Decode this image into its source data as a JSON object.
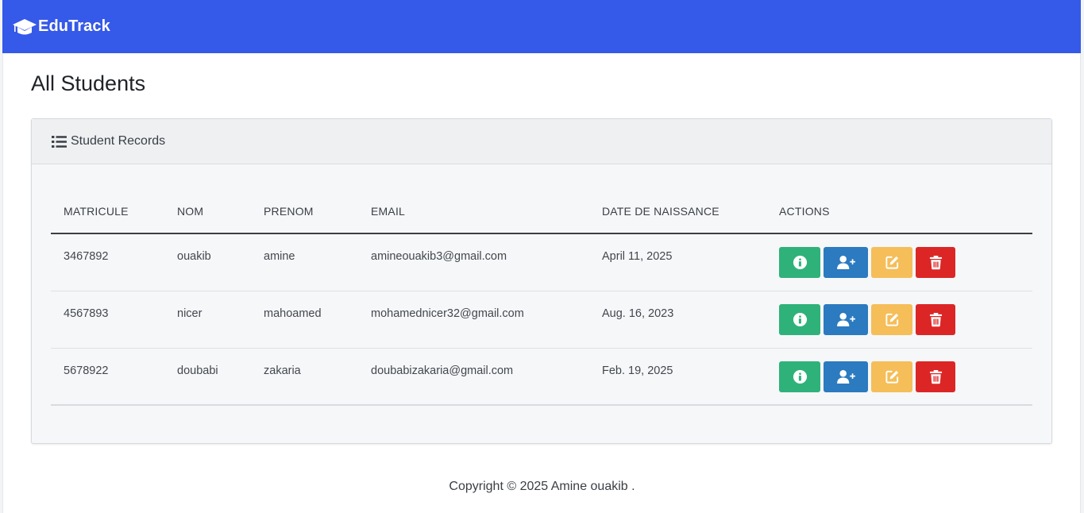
{
  "brand": {
    "name": "EduTrack",
    "icon": "graduation-cap-icon"
  },
  "page": {
    "title": "All Students"
  },
  "card": {
    "title": "Student Records",
    "icon": "list-icon"
  },
  "table": {
    "headers": [
      "MATRICULE",
      "NOM",
      "PRENOM",
      "EMAIL",
      "DATE DE NAISSANCE",
      "ACTIONS"
    ],
    "rows": [
      {
        "matricule": "3467892",
        "nom": "ouakib",
        "prenom": "amine",
        "email": "amineouakib3@gmail.com",
        "date": "April 11, 2025"
      },
      {
        "matricule": "4567893",
        "nom": "nicer",
        "prenom": "mahoamed",
        "email": "mohamednicer32@gmail.com",
        "date": "Aug. 16, 2023"
      },
      {
        "matricule": "5678922",
        "nom": "doubabi",
        "prenom": "zakaria",
        "email": "doubabizakaria@gmail.com",
        "date": "Feb. 19, 2025"
      }
    ],
    "actions": [
      {
        "name": "info",
        "icon": "info-circle-icon",
        "color": "#2fb27a"
      },
      {
        "name": "add",
        "icon": "user-plus-icon",
        "color": "#2c7abf"
      },
      {
        "name": "edit",
        "icon": "edit-icon",
        "color": "#f5be59"
      },
      {
        "name": "delete",
        "icon": "trash-icon",
        "color": "#dc2626"
      }
    ]
  },
  "footer": {
    "text": "Copyright © 2025 Amine ouakib ."
  },
  "colors": {
    "navbar": "#3559e8",
    "card_header": "#eef0f2"
  }
}
